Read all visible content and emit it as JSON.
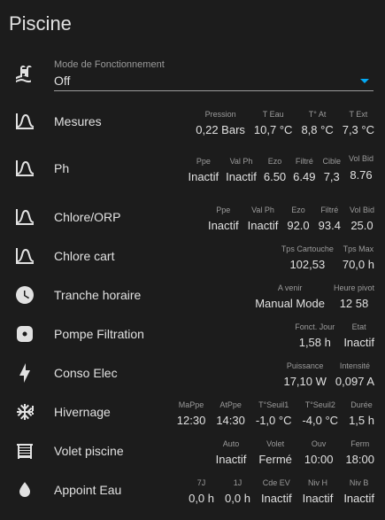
{
  "title": "Piscine",
  "mode": {
    "label": "Mode de Fonctionnement",
    "value": "Off"
  },
  "rows": [
    {
      "name": "Mesures",
      "attrs": [
        {
          "k": "Pression",
          "v": "0,22 Bars"
        },
        {
          "k": "T Eau",
          "v": "10,7 °C"
        },
        {
          "k": "T° At",
          "v": "8,8 °C"
        },
        {
          "k": "T Ext",
          "v": "7,3 °C"
        }
      ]
    },
    {
      "name": "Ph",
      "attrs": [
        {
          "k": "Ppe",
          "v": "Inactif"
        },
        {
          "k": "Val Ph",
          "v": "Inactif"
        },
        {
          "k": "Ezo",
          "v": "6.50"
        },
        {
          "k": "Filtré",
          "v": "6.49"
        },
        {
          "k": "Cible",
          "v": "7,3"
        },
        {
          "k": "Vol Bid",
          "v": "8.76"
        }
      ]
    },
    {
      "name": "Chlore/ORP",
      "attrs": [
        {
          "k": "Ppe",
          "v": "Inactif"
        },
        {
          "k": "Val Ph",
          "v": "Inactif"
        },
        {
          "k": "Ezo",
          "v": "92.0"
        },
        {
          "k": "Filtré",
          "v": "93.4"
        },
        {
          "k": "Vol Bid",
          "v": "25.0"
        }
      ]
    },
    {
      "name": "Chlore cart",
      "attrs": [
        {
          "k": "Tps Cartouche",
          "v": "102,53"
        },
        {
          "k": "Tps Max",
          "v": "70,0 h"
        }
      ]
    },
    {
      "name": "Tranche horaire",
      "attrs": [
        {
          "k": "A venir",
          "v": "Manual Mode"
        },
        {
          "k": "Heure pivot",
          "v": "12 58"
        }
      ]
    },
    {
      "name": "Pompe Filtration",
      "attrs": [
        {
          "k": "Fonct. Jour",
          "v": "1,58 h"
        },
        {
          "k": "Etat",
          "v": "Inactif"
        }
      ]
    },
    {
      "name": "Conso Elec",
      "attrs": [
        {
          "k": "Puissance",
          "v": "17,10 W"
        },
        {
          "k": "Intensité",
          "v": "0,097 A"
        }
      ]
    },
    {
      "name": "Hivernage",
      "attrs": [
        {
          "k": "MaPpe",
          "v": "12:30"
        },
        {
          "k": "AtPpe",
          "v": "14:30"
        },
        {
          "k": "T°Seuil1",
          "v": "-1,0 °C"
        },
        {
          "k": "T°Seuil2",
          "v": "-4,0 °C"
        },
        {
          "k": "Durée",
          "v": "1,5 h"
        }
      ]
    },
    {
      "name": "Volet piscine",
      "attrs": [
        {
          "k": "Auto",
          "v": "Inactif"
        },
        {
          "k": "Volet",
          "v": "Fermé"
        },
        {
          "k": "Ouv",
          "v": "10:00"
        },
        {
          "k": "Ferm",
          "v": "18:00"
        }
      ]
    },
    {
      "name": "Appoint Eau",
      "attrs": [
        {
          "k": "7J",
          "v": "0,0 h"
        },
        {
          "k": "1J",
          "v": "0,0 h"
        },
        {
          "k": "Cde EV",
          "v": "Inactif"
        },
        {
          "k": "Niv H",
          "v": "Inactif"
        },
        {
          "k": "Niv B",
          "v": "Inactif"
        }
      ]
    }
  ],
  "icons": [
    "pool-icon",
    "chart-bell-curve-icon",
    "chart-bell-curve-icon",
    "chart-bell-curve-icon",
    "chart-bell-curve-icon",
    "clock-icon",
    "pump-icon",
    "lightning-bolt-icon",
    "snowflake-alert-icon",
    "window-shutter-icon",
    "water-drop-icon"
  ],
  "colors": {
    "background": "#1c1c1c",
    "text": "#e1e1e1",
    "secondary": "#9b9b9b",
    "accent": "#03a9f4"
  }
}
